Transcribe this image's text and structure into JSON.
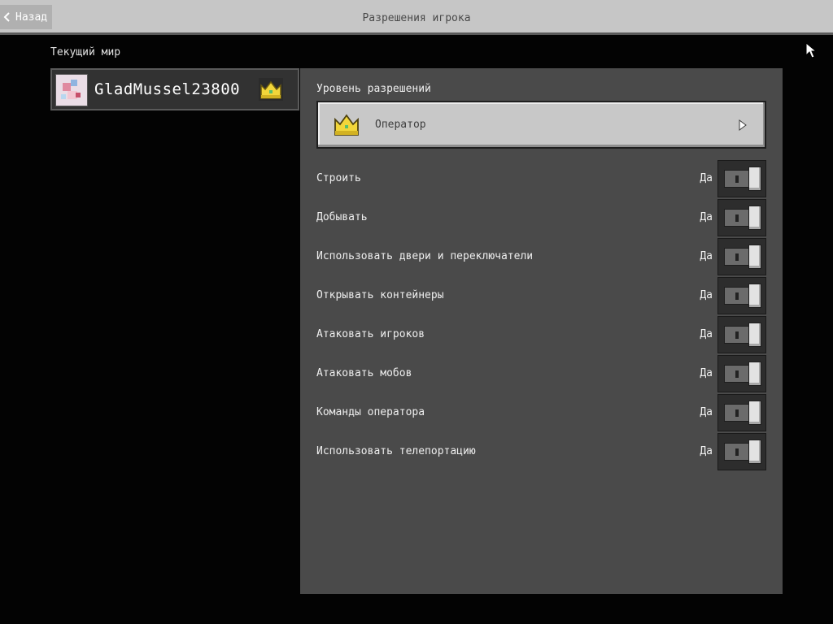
{
  "header": {
    "back_label": "Назад",
    "title": "Разрешения игрока"
  },
  "world_label": "Текущий мир",
  "player": {
    "name": "GladMussel23800",
    "role_icon": "crown-icon"
  },
  "permission_level": {
    "label": "Уровень разрешений",
    "value": "Оператор",
    "icon": "crown-icon"
  },
  "permissions": [
    {
      "label": "Строить",
      "state": "Да",
      "on": true
    },
    {
      "label": "Добывать",
      "state": "Да",
      "on": true
    },
    {
      "label": "Использовать двери и переключатели",
      "state": "Да",
      "on": true
    },
    {
      "label": "Открывать контейнеры",
      "state": "Да",
      "on": true
    },
    {
      "label": "Атаковать игроков",
      "state": "Да",
      "on": true
    },
    {
      "label": "Атаковать мобов",
      "state": "Да",
      "on": true
    },
    {
      "label": "Команды оператора",
      "state": "Да",
      "on": true
    },
    {
      "label": "Использовать телепортацию",
      "state": "Да",
      "on": true
    }
  ],
  "colors": {
    "crown": "#f2d63a",
    "panel": "#4a4a4a",
    "topbar": "#c6c6c6"
  }
}
